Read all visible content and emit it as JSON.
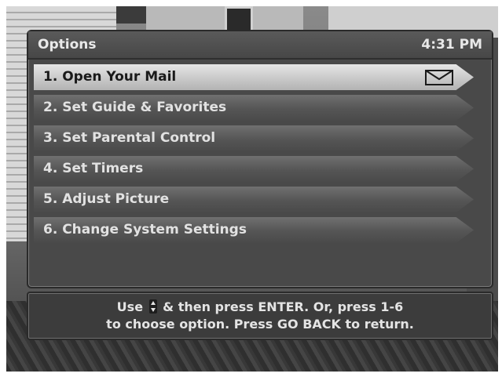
{
  "header": {
    "title": "Options",
    "time": "4:31 PM"
  },
  "menu": {
    "items": [
      {
        "label": "1.  Open Your Mail",
        "selected": true,
        "icon": "mail-envelope-icon"
      },
      {
        "label": "2.  Set Guide & Favorites",
        "selected": false
      },
      {
        "label": "3.  Set Parental Control",
        "selected": false
      },
      {
        "label": "4.  Set Timers",
        "selected": false
      },
      {
        "label": "5.  Adjust Picture",
        "selected": false
      },
      {
        "label": "6.  Change System Settings",
        "selected": false
      }
    ]
  },
  "footer": {
    "line1_before": "Use ",
    "line1_after": " & then press ENTER.  Or, press 1-6",
    "line2": "to choose option.  Press GO BACK to return.",
    "updown_icon": "up-down-arrows-icon"
  },
  "colors": {
    "panel": "#494949",
    "selected_item": "#c9c9c9",
    "item": "#555555",
    "text": "#e2e2e2"
  }
}
